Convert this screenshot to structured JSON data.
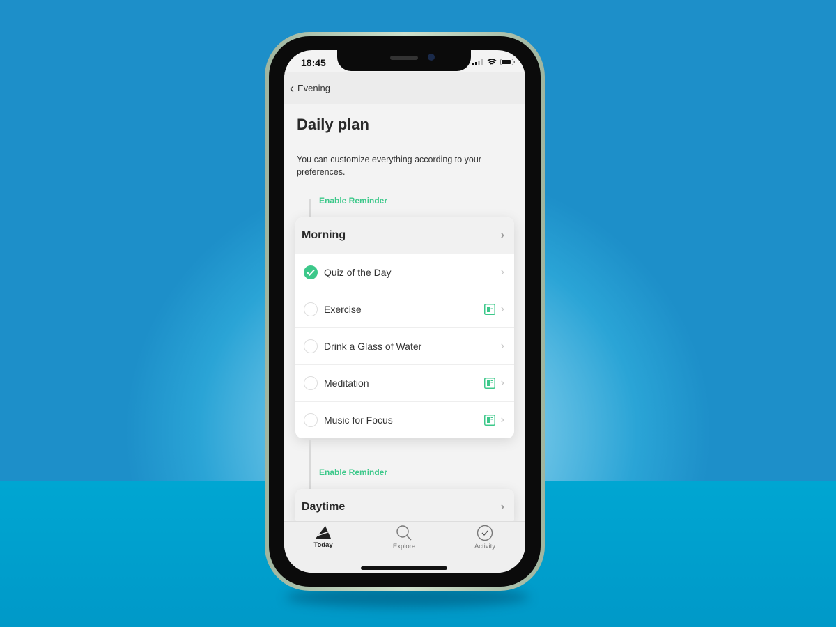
{
  "status_bar": {
    "time": "18:45"
  },
  "nav": {
    "back_label": "Evening"
  },
  "page": {
    "title": "Daily plan",
    "description": "You can customize everything according to your preferences."
  },
  "sections": [
    {
      "reminder": "Enable Reminder",
      "title": "Morning",
      "items": [
        {
          "label": "Quiz of the Day",
          "done": true,
          "has_content_icon": false
        },
        {
          "label": "Exercise",
          "done": false,
          "has_content_icon": true
        },
        {
          "label": "Drink a Glass of Water",
          "done": false,
          "has_content_icon": false
        },
        {
          "label": "Meditation",
          "done": false,
          "has_content_icon": true
        },
        {
          "label": "Music for Focus",
          "done": false,
          "has_content_icon": true
        }
      ]
    },
    {
      "reminder": "Enable Reminder",
      "title": "Daytime",
      "items": []
    }
  ],
  "tabbar": {
    "tabs": [
      {
        "label": "Today",
        "icon": "today-icon",
        "active": true
      },
      {
        "label": "Explore",
        "icon": "search-icon"
      },
      {
        "label": "Activity",
        "icon": "check-circle-icon"
      }
    ]
  },
  "colors": {
    "accent": "#3cc88a"
  }
}
